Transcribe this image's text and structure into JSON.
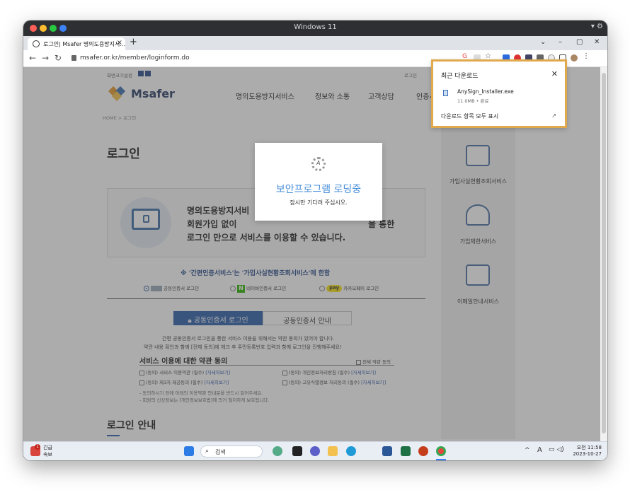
{
  "window": {
    "title": "Windows 11"
  },
  "tab": {
    "title": "로그인| Msafer 명의도용방지서..."
  },
  "toolbar": {
    "url": "msafer.or.kr/member/loginform.do"
  },
  "site": {
    "top_left_text": "화면크기설정",
    "top_right_text": "로그인",
    "logo": "Msafer",
    "nav": [
      "명의도용방지서비스",
      "정보와 소통",
      "고객상담",
      "인증서"
    ],
    "breadcrumb": "HOME > 로그인",
    "page_title": "로그인",
    "info_line1": "명의도용방지서비",
    "info_line2": "회원가입 없이",
    "info_line2_end": "을 통한",
    "info_line3": "로그인 만으로 서비스를 이용할 수 있습니다.",
    "notice": "※ '간편인증서비스'는 '가입사실현황조회서비스'에 한함",
    "radio_options": [
      "공동인증서 로그인",
      "네이버인증서 로그인",
      "카카오페이 로그인"
    ],
    "kakao_badge": "pay",
    "naver_badge": "N",
    "tab_active": "공동인증서 로그인",
    "tab_inactive": "공동인증서 안내",
    "desc_line1": "간편 공동인증서 로그인을 통한 서비스 이용을 위해서는 약관 동의가 있어야 합니다.",
    "desc_line2": "약관 내용 확인과 함께 [전체 동의]에 체크 후 주민등록번호 입력과 함께 로그인을 진행해주세요!",
    "terms_title": "서비스 이용에 대한 약관 동의",
    "terms_all": "전체 약관 동의",
    "terms": [
      "(동의) 서비스 이용약관 (필수)",
      "(동의) 개인정보처리방침 (필수)",
      "(동의) 제3자 제공동의 (필수)",
      "(동의) 고유식별정보 처리동의 (필수)"
    ],
    "terms_link": "[자세히보기]",
    "terms_note1": "- 동의하시기 전에 아래의 이용약관 안내문을 반드시 읽어주세요.",
    "terms_note2": "- 회원의 신상정보는 [개인정보보호법]에 의거 철저하게 보호됩니다.",
    "login_guide": "로그인 안내",
    "side_items": [
      "가입사실현황조회서비스",
      "가입제한서비스",
      "이메일안내서비스"
    ]
  },
  "modal": {
    "spinner_letter": "A",
    "title": "보안프로그램 로딩중",
    "subtitle": "잠시만 기다려 주십시오."
  },
  "downloads": {
    "header": "최근 다운로드",
    "file_name": "AnySign_Installer.exe",
    "file_meta": "11.0MB • 완료",
    "show_all": "다운로드 항목 모두 표시"
  },
  "taskbar": {
    "alert_title": "긴급",
    "alert_sub": "속보",
    "alert_count": "1",
    "search_placeholder": "검색",
    "ime": "A",
    "time": "오전 11:58",
    "date": "2023-10-27"
  },
  "colors": {
    "accent": "#4a6fa5",
    "modal_title": "#4a90d9",
    "download_border": "#e0a94c"
  }
}
